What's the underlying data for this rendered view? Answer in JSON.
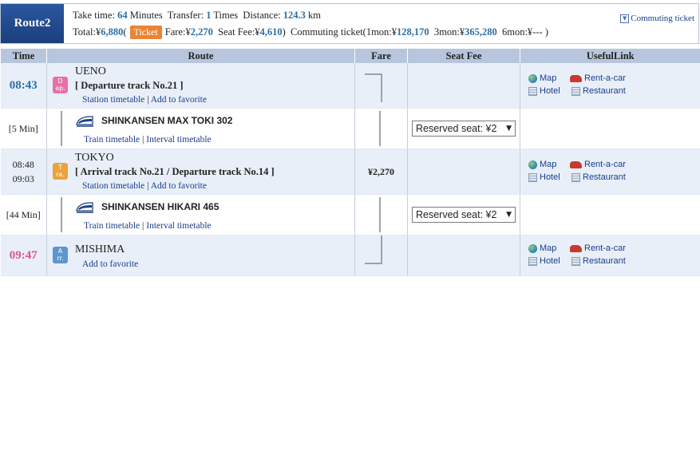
{
  "summary": {
    "route_label": "Route2",
    "take_time_label": "Take time:",
    "take_time_value": "64",
    "take_time_unit": "Minutes",
    "transfer_label": "Transfer:",
    "transfer_value": "1",
    "transfer_unit": "Times",
    "distance_label": "Distance:",
    "distance_value": "124.3",
    "distance_unit": "km",
    "total_label": "Total:¥",
    "total_value": "6,880",
    "paren_open": "(",
    "ticket_badge": "Ticket",
    "fare_label": "Fare:¥",
    "fare_value": "2,270",
    "seat_fee_label": "Seat Fee:¥",
    "seat_fee_value": "4,610",
    "paren_close": ")",
    "commuting_label": "Commuting ticket(1mon:¥",
    "mon1_value": "128,170",
    "mon3_label": "3mon:¥",
    "mon3_value": "365,280",
    "mon6_label": "6mon:¥",
    "mon6_value": "---",
    "commuting_end": ")",
    "commuting_link": "Commuting ticket"
  },
  "table": {
    "headers": [
      "Time",
      "Route",
      "Fare",
      "Seat Fee",
      "UsefulLink"
    ]
  },
  "stations": [
    {
      "time": "08:43",
      "badge": [
        "D",
        "ep."
      ],
      "name": "UENO",
      "track": "[ Departure track No.21 ]",
      "links": [
        "Station timetable",
        "Add to favorite"
      ]
    },
    {
      "time_arr": "08:48",
      "time_dep": "09:03",
      "badge": [
        "T",
        "ra."
      ],
      "name": "TOKYO",
      "track": "[ Arrival track No.21 / Departure track No.14 ]",
      "links": [
        "Station timetable",
        "Add to favorite"
      ],
      "fare": "¥2,270"
    },
    {
      "time": "09:47",
      "badge": [
        "A",
        "rr."
      ],
      "name": "MISHIMA",
      "links": [
        "Add to favorite"
      ]
    }
  ],
  "segments": [
    {
      "duration": "[5 Min]",
      "train": "SHINKANSEN MAX TOKI 302",
      "links": [
        "Train timetable",
        "Interval timetable"
      ],
      "seat": "Reserved seat: ¥2"
    },
    {
      "duration": "[44 Min]",
      "train": "SHINKANSEN HIKARI 465",
      "links": [
        "Train timetable",
        "Interval timetable"
      ],
      "seat": "Reserved seat: ¥2"
    }
  ],
  "useful_links": [
    "Map",
    "Rent-a-car",
    "Hotel",
    "Restaurant"
  ],
  "separator": "|",
  "icons": {
    "map": "globe-icon",
    "car": "car-icon",
    "hotel": "building-icon",
    "restaurant": "building-icon",
    "train": "train-icon",
    "commute": "download-icon"
  },
  "colors": {
    "route_label_bg": "#1b3f7c",
    "ticket_badge": "#e98435",
    "departure_time": "#2a6fa8",
    "arrival_time": "#e0548b",
    "header_bg": "#b7c6dc",
    "station_row_bg": "#e8eff9",
    "dep_badge": "#e96fa8",
    "tra_badge": "#eca33b",
    "arr_badge": "#5f95cf"
  }
}
